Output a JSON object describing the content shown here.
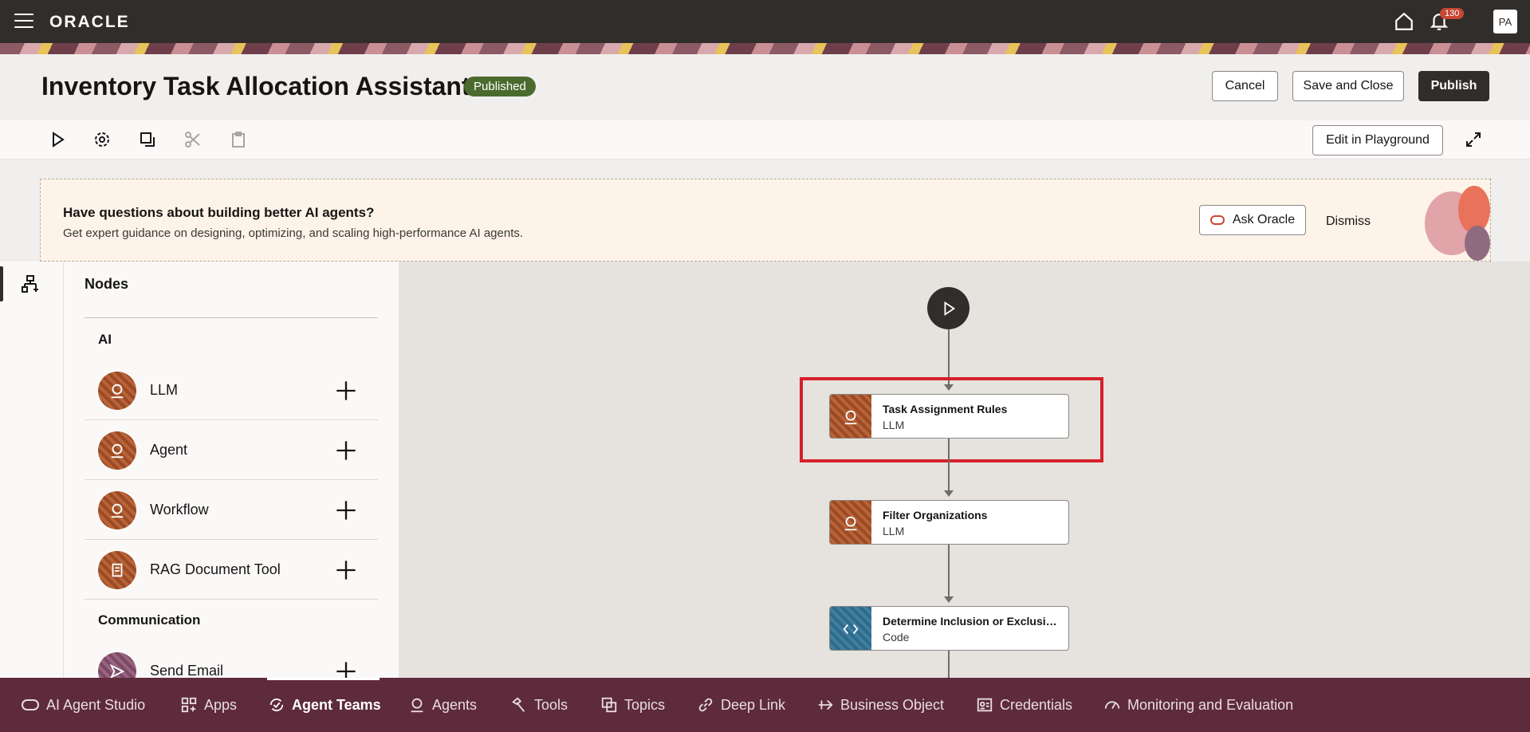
{
  "topbar": {
    "logo": "ORACLE",
    "notification_count": "130",
    "avatar_initials": "PA"
  },
  "header": {
    "title": "Inventory Task Allocation Assistant",
    "status": "Published",
    "cancel": "Cancel",
    "save_close": "Save and Close",
    "publish": "Publish"
  },
  "toolbar": {
    "edit_playground": "Edit in Playground",
    "tools": [
      "play-icon",
      "gear-icon",
      "copy-icon",
      "cut-icon",
      "paste-icon"
    ]
  },
  "promo": {
    "title": "Have questions about building better AI agents?",
    "text": "Get expert guidance on designing, optimizing, and scaling high-performance AI agents.",
    "ask": "Ask Oracle",
    "dismiss": "Dismiss"
  },
  "panel": {
    "title": "Nodes",
    "sections": [
      {
        "name": "AI",
        "items": [
          "LLM",
          "Agent",
          "Workflow",
          "RAG Document Tool"
        ]
      },
      {
        "name": "Communication",
        "items": [
          "Send Email"
        ]
      }
    ]
  },
  "canvas": {
    "nodes": [
      {
        "title": "Task Assignment Rules",
        "type": "LLM"
      },
      {
        "title": "Filter Organizations",
        "type": "LLM"
      },
      {
        "title": "Determine Inclusion or Exclusion ...",
        "type": "Code"
      }
    ]
  },
  "bottomnav": {
    "items": [
      "AI Agent Studio",
      "Apps",
      "Agent Teams",
      "Agents",
      "Tools",
      "Topics",
      "Deep Link",
      "Business Object",
      "Credentials",
      "Monitoring and Evaluation"
    ],
    "active": "Agent Teams"
  },
  "colors": {
    "topbar": "#312d2a",
    "bottomnav": "#5e2b3c",
    "highlight": "#d6202a",
    "published": "#4b6b2e"
  }
}
